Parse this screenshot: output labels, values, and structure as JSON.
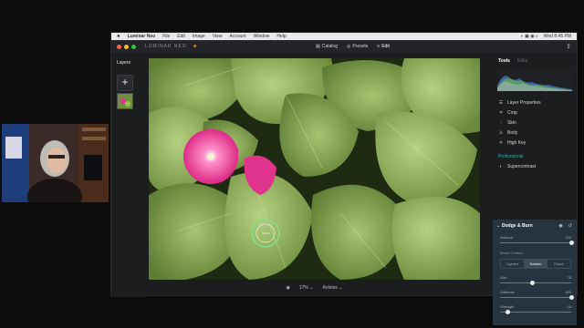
{
  "menubar": {
    "apple": "",
    "app_name": "Luminar Neo",
    "items": [
      "File",
      "Edit",
      "Image",
      "View",
      "Account",
      "Window",
      "Help"
    ],
    "clock": "Wed 8:45 PM"
  },
  "toolbar": {
    "brand": "LUMINAR NEO",
    "nav": [
      {
        "icon": "catalog-icon",
        "label": "Catalog"
      },
      {
        "icon": "presets-icon",
        "label": "Presets"
      },
      {
        "icon": "edit-icon",
        "label": "Edit"
      }
    ]
  },
  "left_panel": {
    "title": "Layers",
    "add_symbol": "+"
  },
  "bottom_bar": {
    "zoom": "17%",
    "actions": "Actions"
  },
  "right_panel": {
    "tabs": [
      {
        "label": "Tools",
        "active": true
      },
      {
        "label": "Edits",
        "active": false
      }
    ],
    "tools": [
      {
        "icon": "layer-properties-icon",
        "label": "Layer Properties"
      },
      {
        "icon": "crop-icon",
        "label": "Crop"
      },
      {
        "icon": "skin-icon",
        "label": "Skin"
      },
      {
        "icon": "body-icon",
        "label": "Body"
      },
      {
        "icon": "high-key-icon",
        "label": "High Key"
      }
    ],
    "section_professional": "Professional",
    "supercontrast": "Supercontrast",
    "dodge_burn": {
      "title": "Dodge & Burn",
      "amount_label": "Amount",
      "amount_value": "100",
      "brush_control": "Brush Control",
      "modes": [
        {
          "label": "Lighten",
          "on": false
        },
        {
          "label": "Darken",
          "on": true
        },
        {
          "label": "Erase",
          "on": false
        }
      ],
      "sliders": [
        {
          "label": "Size",
          "value": "75",
          "pct": 0.45
        },
        {
          "label": "Softness",
          "value": "100",
          "pct": 1.0
        },
        {
          "label": "Strength",
          "value": "10",
          "pct": 0.1
        }
      ],
      "amount_pct": 1.0
    }
  },
  "colors": {
    "accent": "#2fb2a6",
    "panel_active": "#26343f",
    "window_close": "#ff5f57",
    "window_min": "#febc2e",
    "window_max": "#28c840"
  }
}
